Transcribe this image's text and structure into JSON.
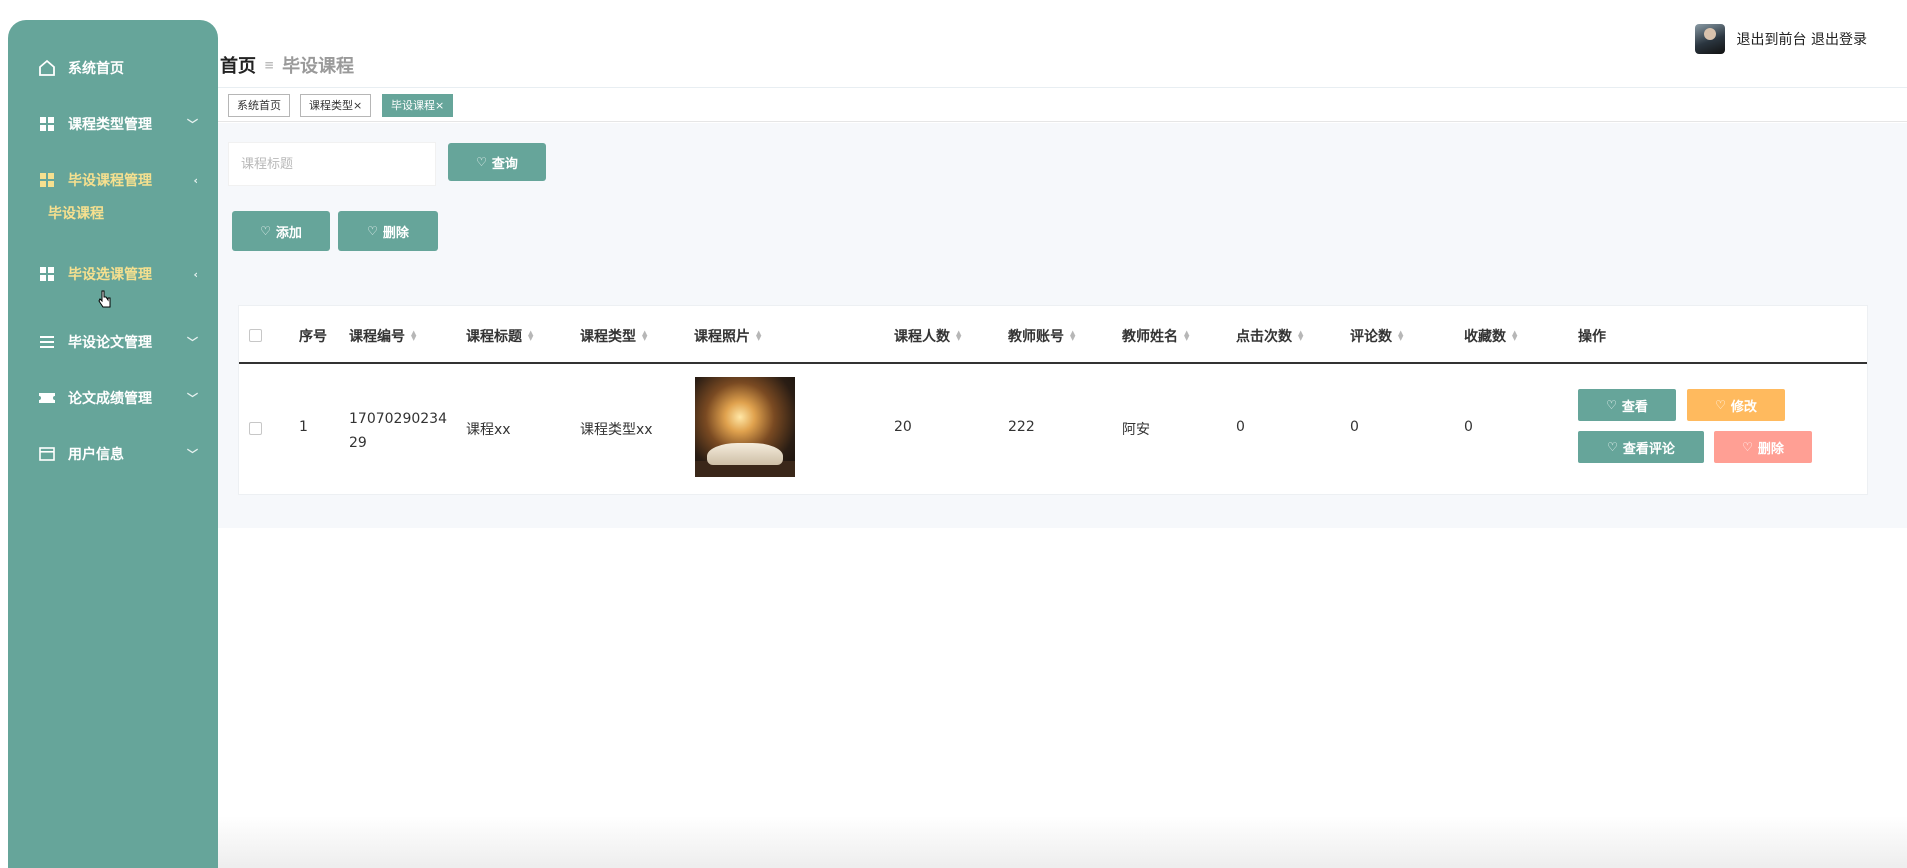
{
  "sidebar": {
    "items": [
      {
        "label": "系统首页",
        "icon": "home-icon"
      },
      {
        "label": "课程类型管理",
        "icon": "grid-icon"
      },
      {
        "label": "毕设课程管理",
        "icon": "grid-icon"
      },
      {
        "label": "毕设选课管理",
        "icon": "grid-icon"
      },
      {
        "label": "毕设论文管理",
        "icon": "list-icon"
      },
      {
        "label": "论文成绩管理",
        "icon": "ticket-icon"
      },
      {
        "label": "用户信息",
        "icon": "card-icon"
      }
    ],
    "submenu": {
      "label": "毕设课程"
    },
    "colors": {
      "background": "#66a59a",
      "active_text": "#f6e08f"
    }
  },
  "breadcrumb": {
    "home": "首页",
    "current": "毕设课程"
  },
  "user": {
    "front_link": "退出到前台",
    "logout_link": "退出登录"
  },
  "tags": [
    {
      "label": "系统首页",
      "closable": false
    },
    {
      "label": "课程类型",
      "closable": true
    },
    {
      "label": "毕设课程",
      "closable": true
    }
  ],
  "search": {
    "placeholder": "课程标题",
    "button": "查询"
  },
  "actions": {
    "add": "添加",
    "delete": "删除"
  },
  "table": {
    "columns": [
      "序号",
      "课程编号",
      "课程标题",
      "课程类型",
      "课程照片",
      "课程人数",
      "教师账号",
      "教师姓名",
      "点击次数",
      "评论数",
      "收藏数",
      "操作"
    ],
    "rows": [
      {
        "index": "1",
        "code_line1": "17070290234",
        "code_line2": "29",
        "title": "课程xx",
        "type": "课程类型xx",
        "people": "20",
        "teacher_account": "222",
        "teacher_name": "阿安",
        "clicks": "0",
        "comments": "0",
        "favorites": "0"
      }
    ],
    "row_actions": {
      "view": "查看",
      "edit": "修改",
      "view_comments": "查看评论",
      "delete": "删除"
    }
  },
  "close_symbol": "×"
}
